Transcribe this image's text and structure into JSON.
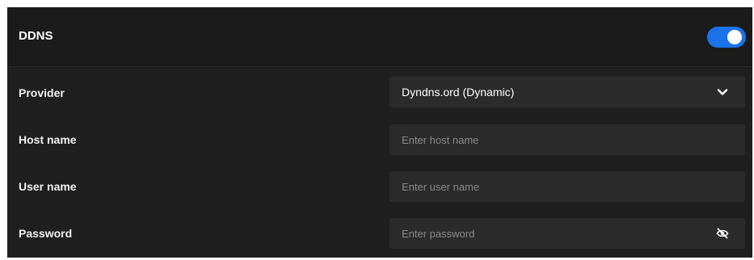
{
  "ddns": {
    "title": "DDNS",
    "enabled": true
  },
  "form": {
    "provider_label": "Provider",
    "provider_value": "Dyndns.ord (Dynamic)",
    "host_label": "Host name",
    "host_placeholder": "Enter host name",
    "user_label": "User name",
    "user_placeholder": "Enter user name",
    "password_label": "Password",
    "password_placeholder": "Enter password"
  },
  "colors": {
    "accent": "#1a73e8",
    "panel_background": "#1f1f1f",
    "field_background": "#2b2b2b"
  },
  "icons": {
    "dropdown": "chevron-down-icon",
    "visibility": "eye-off-icon"
  }
}
